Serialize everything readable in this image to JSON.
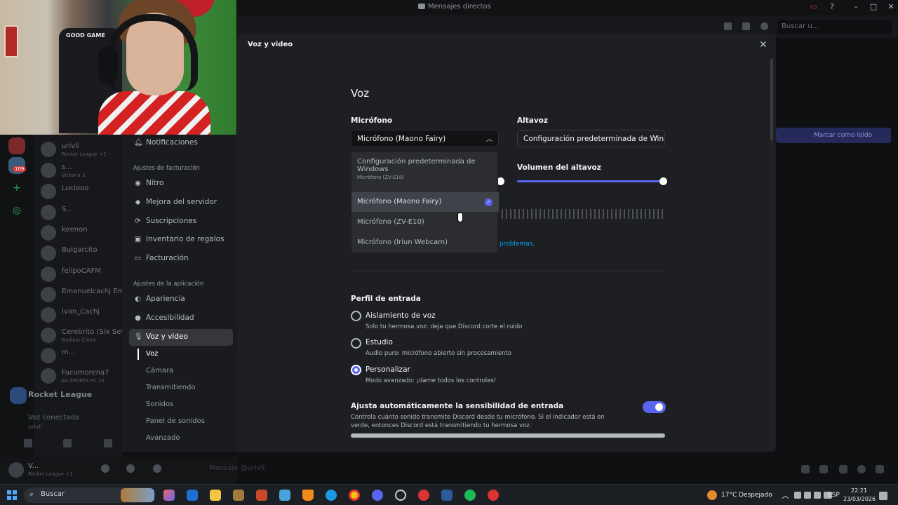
{
  "window": {
    "title": "Mensajes directos"
  },
  "header": {
    "search_placeholder": "Buscar u...",
    "mark_read_label": "Marcar como leído"
  },
  "webcam": {
    "chair_text": "GOOD GAME"
  },
  "dm_list": {
    "items": [
      {
        "name": "urivli",
        "sub": "Rocket League +1 ·"
      },
      {
        "name": "s...",
        "sub": "Victoria 3"
      },
      {
        "name": "Luciooo",
        "sub": ""
      },
      {
        "name": "S...",
        "sub": ""
      },
      {
        "name": "keenon",
        "sub": ""
      },
      {
        "name": "Bulgarcito",
        "sub": ""
      },
      {
        "name": "felipoCAFM",
        "sub": ""
      },
      {
        "name": "Emanuelcachj Em",
        "sub": ""
      },
      {
        "name": "Ivan_Cachj",
        "sub": ""
      },
      {
        "name": "Cerebrito (Six Seve",
        "sub": "Badlion Client"
      },
      {
        "name": "m...",
        "sub": ""
      },
      {
        "name": "Facumorena7",
        "sub": "EA SPORTS FC 26"
      }
    ],
    "badge": "109",
    "activity": "Rocket League",
    "voice_status": "Voz conectada",
    "voice_user": "urivli"
  },
  "userbar": {
    "name": "V...",
    "sub": "Rocket League +1",
    "message_placeholder": "Mensaje @urivli"
  },
  "sidebar": {
    "top_item": "Notificaciones",
    "billing_header": "Ajustes de facturación",
    "billing_items": [
      "Nitro",
      "Mejora del servidor",
      "Suscripciones",
      "Inventario de regalos",
      "Facturación"
    ],
    "app_header": "Ajustes de la aplicación",
    "app_items": [
      "Apariencia",
      "Accesibilidad",
      "Voz y video"
    ],
    "sub_items": [
      "Voz",
      "Cámara",
      "Transmitiendo",
      "Sonidos",
      "Panel de sonidos",
      "Avanzado"
    ]
  },
  "modal": {
    "title": "Voz y video",
    "section_title": "Voz",
    "mic_label": "Micrófono",
    "mic_value": "Micrófono (Maono Fairy)",
    "speaker_label": "Altavoz",
    "speaker_value": "Configuración predeterminada de Win",
    "speaker_volume_label": "Volumen del altavoz",
    "speaker_volume": 1.0,
    "problems_link": "problemas.",
    "dropdown_options": [
      {
        "label": "Configuración predeterminada de Windows",
        "sub": "Micrófono (ZV-E10)",
        "selected": false
      },
      {
        "label": "Micrófono (Maono Fairy)",
        "sub": "",
        "selected": true
      },
      {
        "label": "Micrófono (ZV-E10)",
        "sub": "",
        "selected": false
      },
      {
        "label": "Micrófono (Iriun Webcam)",
        "sub": "",
        "selected": false
      }
    ],
    "input_profile_title": "Perfil de entrada",
    "profiles": [
      {
        "title": "Aislamiento de voz",
        "desc": "Solo tu hermosa voz: deja que Discord corte el ruido",
        "selected": false
      },
      {
        "title": "Estudio",
        "desc": "Audio puro: micrófono abierto sin procesamiento",
        "selected": false
      },
      {
        "title": "Personalizar",
        "desc": "Modo avanzado: ¡dame todos los controles!",
        "selected": true
      }
    ],
    "auto_sensitivity_title": "Ajusta automáticamente la sensibilidad de entrada",
    "auto_sensitivity_desc": "Controla cuánto sonido transmite Discord desde tu micrófono. Si el indicador está en verde, entonces Discord está transmitiendo tu hermosa voz.",
    "auto_sensitivity_on": true
  },
  "taskbar": {
    "search_label": "Buscar",
    "weather": "17°C Despejado",
    "lang": "ESP",
    "time": "22:21",
    "date": "23/03/2026"
  },
  "colors": {
    "blurple": "#5865f2",
    "bg": "#1e1f22",
    "link": "#00a8fc"
  }
}
